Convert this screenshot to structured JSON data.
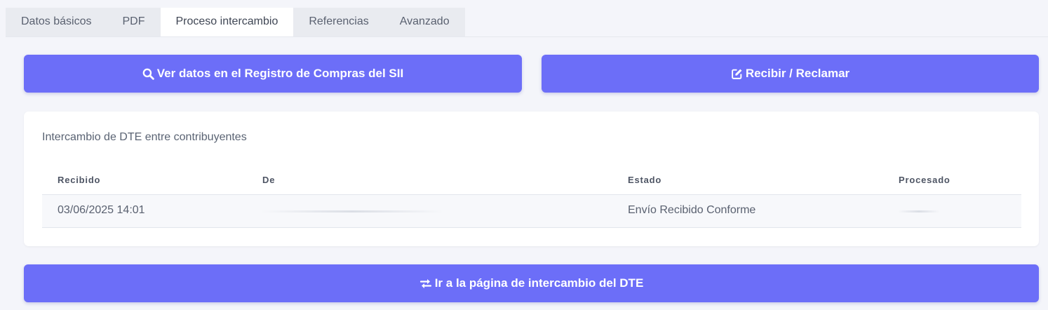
{
  "tabs": [
    {
      "label": "Datos básicos",
      "active": false
    },
    {
      "label": "PDF",
      "active": false
    },
    {
      "label": "Proceso intercambio",
      "active": true
    },
    {
      "label": "Referencias",
      "active": false
    },
    {
      "label": "Avanzado",
      "active": false
    }
  ],
  "actions": {
    "view_registry_label": "Ver datos en el Registro de Compras del SII",
    "receive_claim_label": "Recibir / Reclamar",
    "exchange_page_label": "Ir a la página de intercambio del DTE"
  },
  "exchange": {
    "title": "Intercambio de DTE entre contribuyentes",
    "columns": [
      "Recibido",
      "De",
      "Estado",
      "Procesado"
    ],
    "rows": [
      {
        "recibido": "03/06/2025 14:01",
        "de": "",
        "estado": "Envío Recibido Conforme",
        "procesado": ""
      }
    ]
  },
  "colors": {
    "accent": "#6c6ef8",
    "background": "#f4f5fa"
  },
  "icons": {
    "view_registry": "search-icon",
    "receive_claim": "edit-icon",
    "exchange_page": "exchange-arrows-icon"
  }
}
